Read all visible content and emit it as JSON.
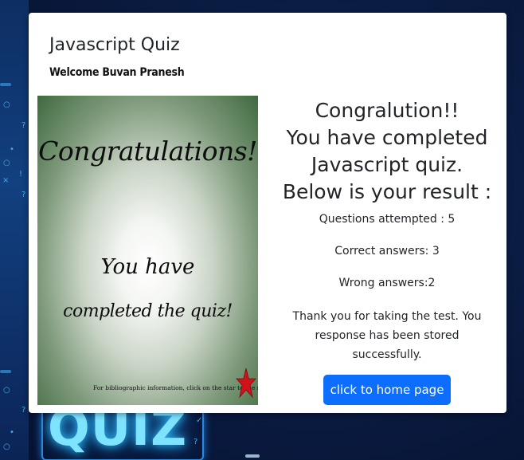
{
  "modal": {
    "title": "Javascript Quiz",
    "welcome": "Welcome Buvan Pranesh"
  },
  "card": {
    "congrats": "Congratulations!",
    "line1": "You have",
    "line2": "completed the quiz!",
    "bibliographic": "For bibliographic information, click on the star to the right",
    "star_icon": "red-star-icon",
    "star_color": "#d0121b"
  },
  "results": {
    "heading_lines": [
      "Congralution!!",
      "You have completed",
      "Javascript quiz.",
      "Below is your result :"
    ],
    "attempted": "Questions attempted : 5",
    "correct": "Correct answers: 3",
    "wrong": "Wrong answers:2",
    "thanks": "Thank you for taking the test. You response has been stored successfully.",
    "home_button": "click to home page"
  },
  "background": {
    "logo_text": "QUIZ"
  },
  "colors": {
    "primary_button": "#0d6efd",
    "modal_bg": "#ffffff",
    "page_bg": "#0b1d45"
  }
}
